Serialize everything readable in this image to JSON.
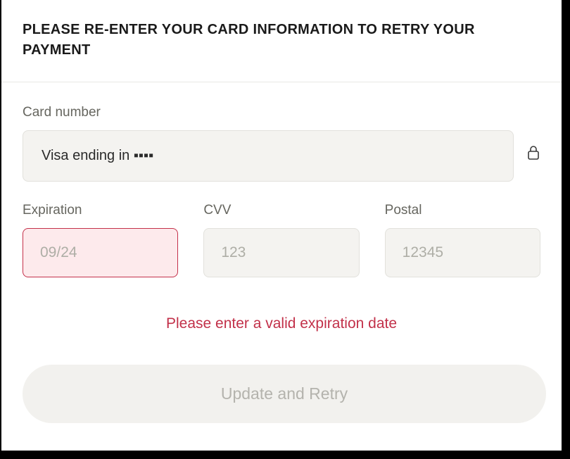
{
  "header": {
    "title": "PLEASE RE-ENTER YOUR CARD INFORMATION TO RETRY YOUR PAYMENT"
  },
  "form": {
    "card_number": {
      "label": "Card number",
      "value": "Visa ending in ▪▪▪▪"
    },
    "expiration": {
      "label": "Expiration",
      "placeholder": "09/24",
      "value": "",
      "has_error": true
    },
    "cvv": {
      "label": "CVV",
      "placeholder": "123",
      "value": ""
    },
    "postal": {
      "label": "Postal",
      "placeholder": "12345",
      "value": ""
    },
    "error_message": "Please enter a valid expiration date",
    "submit_label": "Update and Retry"
  },
  "icons": {
    "lock": "lock-icon"
  }
}
